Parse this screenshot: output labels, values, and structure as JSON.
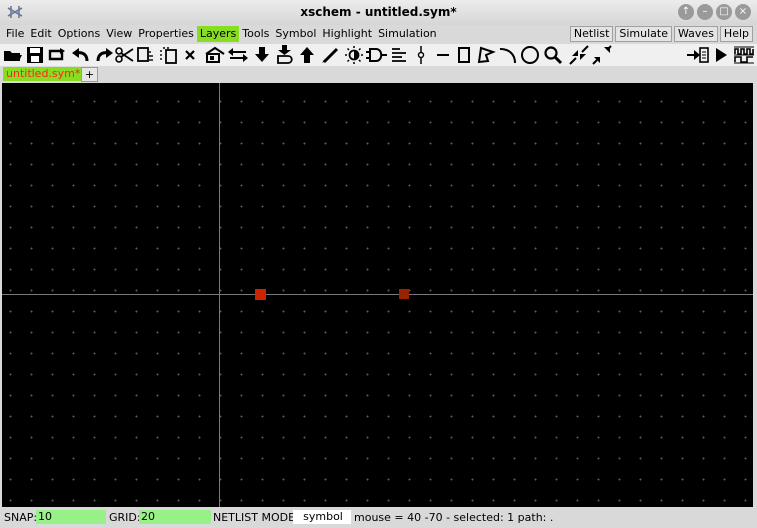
{
  "window": {
    "title": "xschem - untitled.sym*",
    "buttons": [
      "↑",
      "–",
      "□",
      "×"
    ]
  },
  "menu": {
    "left": [
      "File",
      "Edit",
      "Options",
      "View",
      "Properties",
      "Layers",
      "Tools",
      "Symbol",
      "Highlight",
      "Simulation"
    ],
    "active": "Layers",
    "right": [
      "Netlist",
      "Simulate",
      "Waves",
      "Help"
    ]
  },
  "tabs": {
    "current": "untitled.sym*",
    "add": "+"
  },
  "toolbar": {
    "icons": [
      "open-folder-icon",
      "save-icon",
      "reload-icon",
      "undo-icon",
      "redo-icon",
      "cut-icon",
      "copy-icon",
      "paste-icon",
      "delete-icon",
      "symbol-library-icon",
      "swap-icon",
      "push-down-icon",
      "descend-icon",
      "push-up-icon",
      "wire-pen-icon",
      "light-icon",
      "gate-icon",
      "lines-icon",
      "pin-icon",
      "line-icon",
      "rectangle-icon",
      "polygon-icon",
      "arc-icon",
      "circle-icon",
      "zoom-icon",
      "zoom-in-icon",
      "zoom-out-icon",
      "netlist-arrow-icon",
      "simulate-play-icon",
      "waves-icon"
    ]
  },
  "status": {
    "snap_label": "SNAP:",
    "snap_value": "10",
    "grid_label": "GRID:",
    "grid_value": "20",
    "mode_label": "NETLIST MODE:",
    "mode_value": "symbol",
    "info": "mouse = 40 -70 - selected: 1 path: ."
  },
  "colors": {
    "active_menu": "#88dd22",
    "tab_text": "#ff2222",
    "canvas_bg": "#000000",
    "axis": "#7a7a7a",
    "pin_selected": "#cc2200",
    "pin": "#992200",
    "status_field": "#98f088"
  }
}
